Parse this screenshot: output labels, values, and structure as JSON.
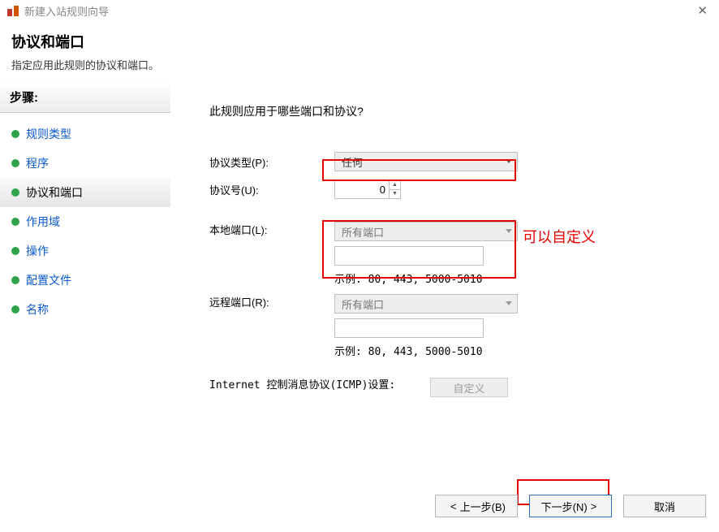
{
  "titlebar": {
    "title": "新建入站规则向导"
  },
  "header": {
    "title": "协议和端口",
    "subtitle": "指定应用此规则的协议和端口。"
  },
  "sidebar": {
    "title": "步骤:",
    "items": [
      {
        "label": "规则类型"
      },
      {
        "label": "程序"
      },
      {
        "label": "协议和端口"
      },
      {
        "label": "作用域"
      },
      {
        "label": "操作"
      },
      {
        "label": "配置文件"
      },
      {
        "label": "名称"
      }
    ]
  },
  "main": {
    "question": "此规则应用于哪些端口和协议?",
    "protocol_type_label": "协议类型(P):",
    "protocol_type_value": "任何",
    "protocol_num_label": "协议号(U):",
    "protocol_num_value": "0",
    "local_port_label": "本地端口(L):",
    "local_port_value": "所有端口",
    "remote_port_label": "远程端口(R):",
    "remote_port_value": "所有端口",
    "example_text": "示例: 80, 443, 5000-5010",
    "icmp_label": "Internet 控制消息协议(ICMP)设置:",
    "icmp_button": "自定义"
  },
  "annotation": "可以自定义",
  "footer": {
    "back": "上一步(B)",
    "next": "下一步(N)",
    "cancel": "取消"
  }
}
